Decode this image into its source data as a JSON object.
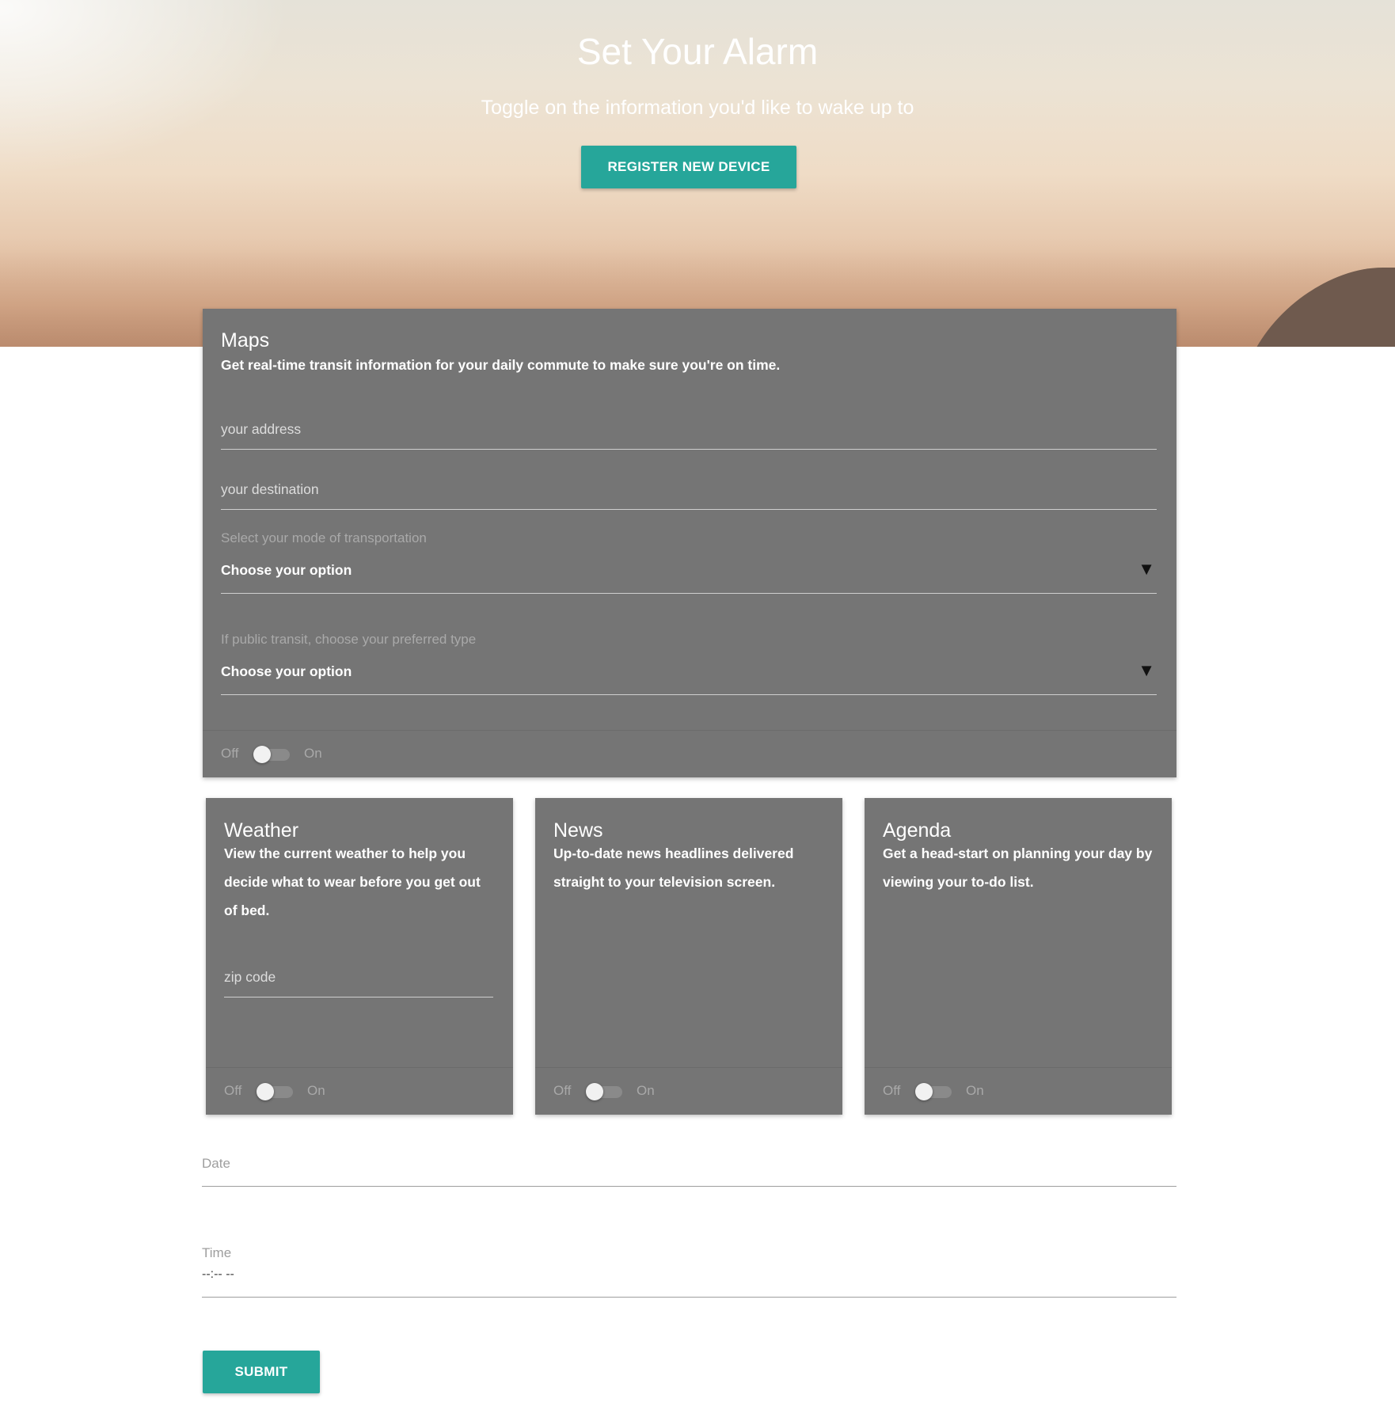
{
  "hero": {
    "title": "Set Your Alarm",
    "subtitle": "Toggle on the information you'd like to wake up to",
    "register_button": "REGISTER NEW DEVICE"
  },
  "maps": {
    "title": "Maps",
    "description": "Get real-time transit information for your daily commute to make sure you're on time.",
    "address_placeholder": "your address",
    "destination_placeholder": "your destination",
    "transport_label": "Select your mode of transportation",
    "transport_value": "Choose your option",
    "transit_label": "If public transit, choose your preferred type",
    "transit_value": "Choose your option",
    "switch_off": "Off",
    "switch_on": "On"
  },
  "weather": {
    "title": "Weather",
    "description": "View the current weather to help you decide what to wear before you get out of bed.",
    "zip_placeholder": "zip code",
    "switch_off": "Off",
    "switch_on": "On"
  },
  "news": {
    "title": "News",
    "description": "Up-to-date news headlines delivered straight to your television screen.",
    "switch_off": "Off",
    "switch_on": "On"
  },
  "agenda": {
    "title": "Agenda",
    "description": "Get a head-start on planning your day by viewing your to-do list.",
    "switch_off": "Off",
    "switch_on": "On"
  },
  "form": {
    "date_label": "Date",
    "time_label": "Time",
    "time_value": "--:-- --",
    "submit_label": "SUBMIT"
  },
  "icons": {
    "select_caret": "▼"
  },
  "colors": {
    "accent": "#26a69a",
    "card": "#757575"
  }
}
